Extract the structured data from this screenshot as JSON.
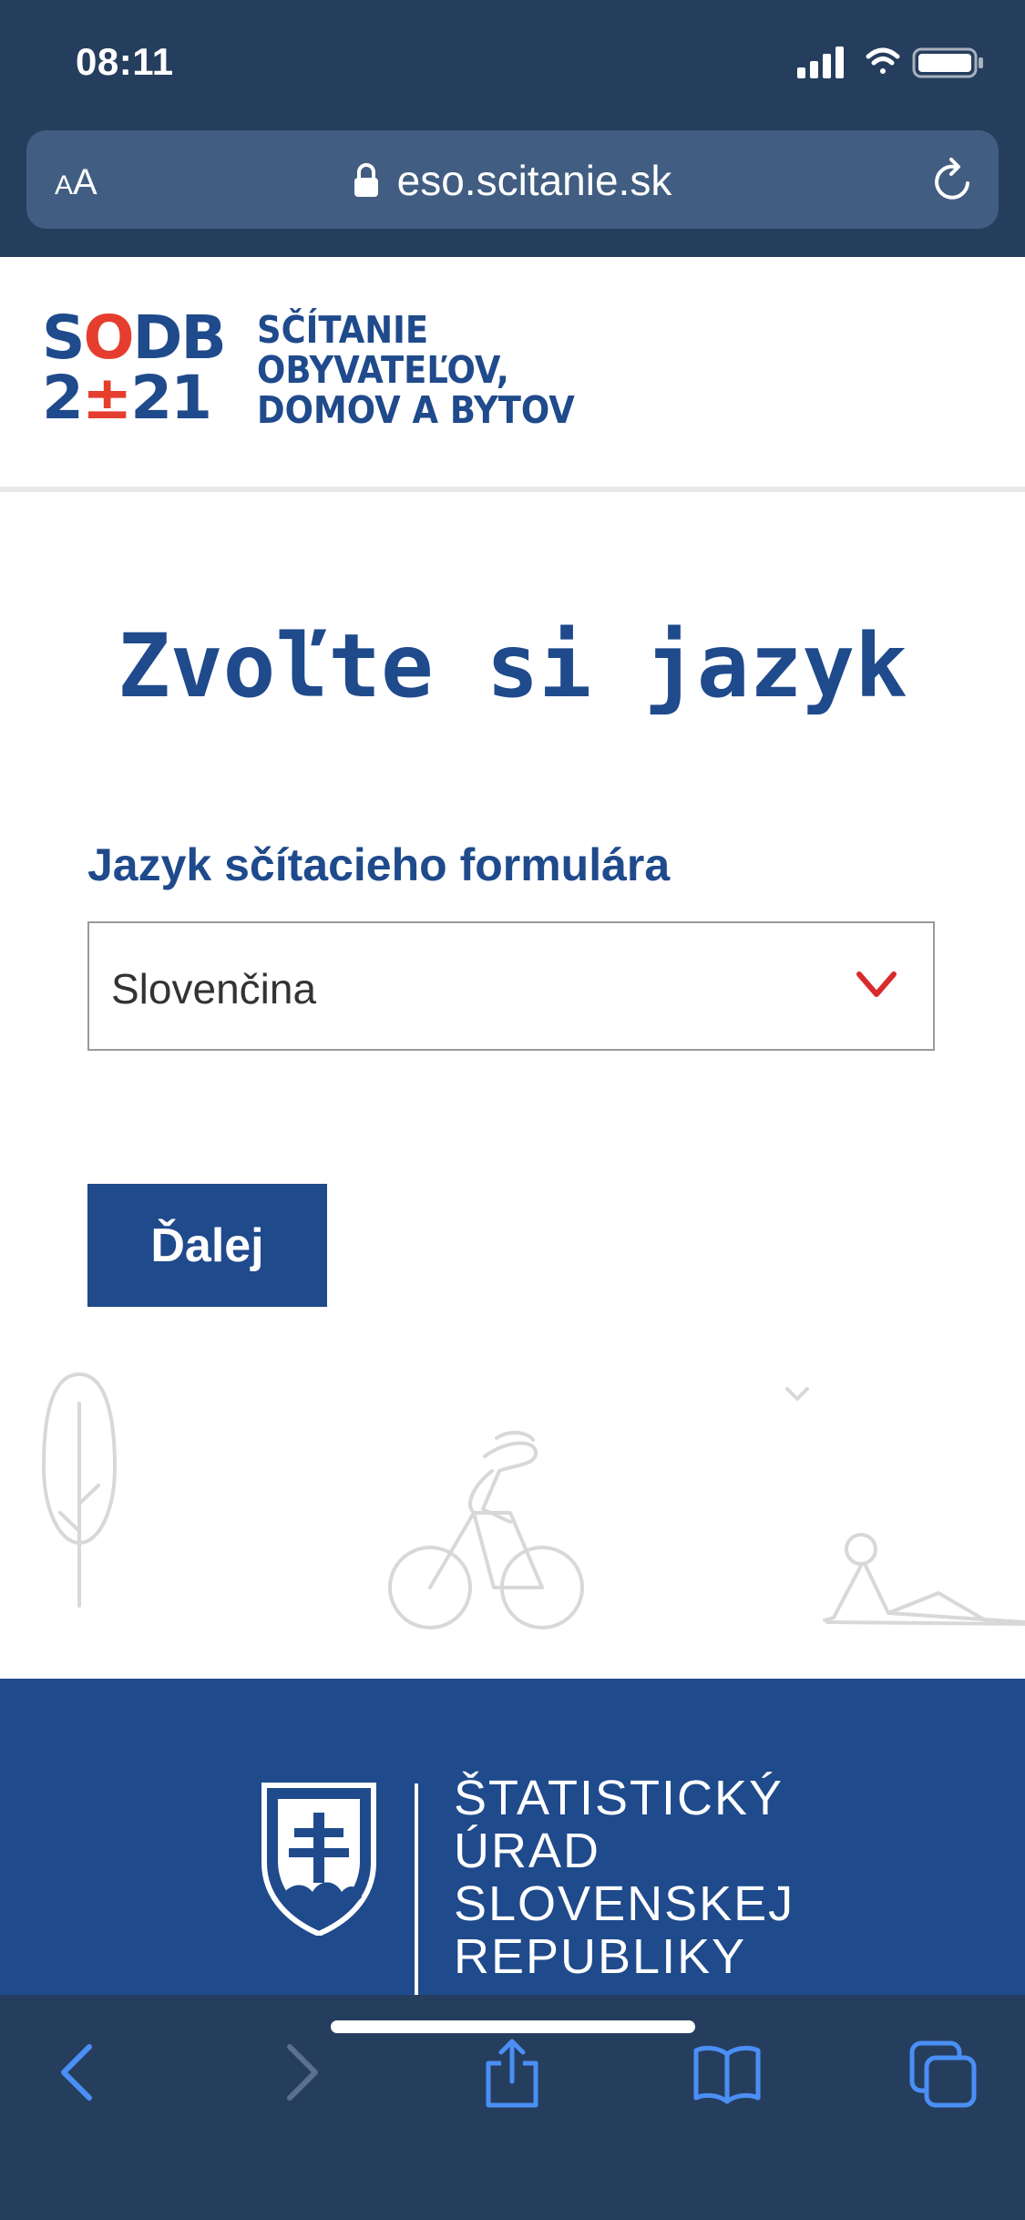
{
  "status_bar": {
    "time": "08:11"
  },
  "browser": {
    "reader_button": {
      "small": "A",
      "large": "A"
    },
    "url": "eso.scitanie.sk"
  },
  "header": {
    "logo_line1": {
      "a": "S",
      "o": "O",
      "b": "DB"
    },
    "logo_line2": {
      "a": "2",
      "o": "±",
      "b": "21"
    },
    "title_lines": [
      "SČÍTANIE",
      "OBYVATEĽOV,",
      "DOMOV A BYTOV"
    ]
  },
  "main": {
    "title": "Zvoľte si jazyk",
    "field_label": "Jazyk sčítacieho formulára",
    "selected_language": "Slovenčina",
    "next_button": "Ďalej"
  },
  "footer": {
    "office_lines": [
      "ŠTATISTICKÝ",
      "ÚRAD",
      "SLOVENSKEJ",
      "REPUBLIKY"
    ]
  },
  "colors": {
    "brand_blue": "#1f4a8c",
    "accent_red": "#e53e2f",
    "chrome": "#263e5e",
    "url_bar": "#415d82"
  },
  "icons": [
    "signal-icon",
    "wifi-icon",
    "battery-icon",
    "lock-icon",
    "reload-icon",
    "chevron-down-icon",
    "back-icon",
    "forward-icon",
    "share-icon",
    "bookmarks-icon",
    "tabs-icon"
  ]
}
